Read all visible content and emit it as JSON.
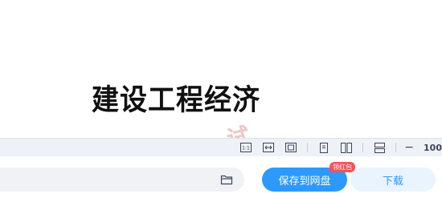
{
  "document": {
    "title": "建设工程经济",
    "watermark": "试"
  },
  "toolbar": {
    "icons": [
      "actual-size-icon",
      "fit-width-icon",
      "fit-page-icon",
      "single-page-icon",
      "double-page-icon",
      "scroll-mode-icon"
    ],
    "zoom_minus": "−",
    "zoom_value": "100"
  },
  "bottom": {
    "path_placeholder": "",
    "save_label": "保存到网盘",
    "badge_label": "领红包",
    "download_label": "下载"
  },
  "colors": {
    "accent": "#2b9afc",
    "badge": "#f6525b",
    "toolbar_bg": "#eef1f6"
  }
}
